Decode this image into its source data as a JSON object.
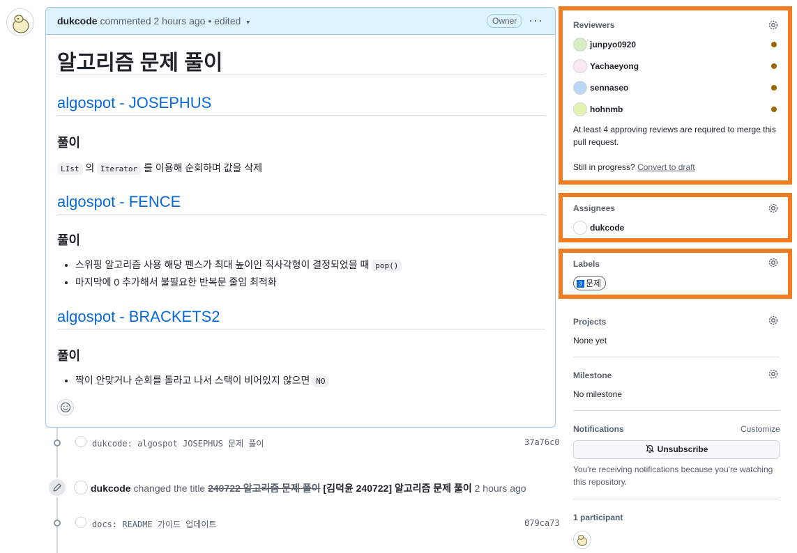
{
  "comment": {
    "author": "dukcode",
    "meta": "commented 2 hours ago • edited",
    "badge": "Owner",
    "menu": "···",
    "title": "알고리즘 문제 풀이",
    "sections": [
      {
        "heading": "algospot - JOSEPHUS",
        "subheading": "풀이",
        "code1": "LIst",
        "text1": "의",
        "code2": "Iterator",
        "text2": "를 이용해 순회하며 값을 삭제"
      },
      {
        "heading": "algospot - FENCE",
        "subheading": "풀이",
        "bullet1_text": "스위핑 알고리즘 사용 해당 펜스가 최대 높이인 직사각형이 결정되었을 때",
        "bullet1_code": "pop()",
        "bullet2_text": "마지막에 0 추가해서 불필요한 반복문 줄임 최적화"
      },
      {
        "heading": "algospot - BRACKETS2",
        "subheading": "풀이",
        "bullet1_text": "짝이 안맞거나 순회를 돌라고 나서 스택이 비어있지 않으면",
        "bullet1_code": "NO"
      }
    ]
  },
  "timeline": {
    "commit1": {
      "message": "dukcode: algospot JOSEPHUS 문제 풀이",
      "sha": "37a76c0"
    },
    "rename": {
      "actor": "dukcode",
      "action": "changed the title",
      "old_title": "240722 알고리즘 문제 풀이",
      "new_title": "[김덕윤 240722] 알고리즘 문제 풀이",
      "time": "2 hours ago"
    },
    "commit2": {
      "message": "docs: README 가이드 업데이트",
      "sha": "079ca73"
    }
  },
  "sidebar": {
    "reviewers": {
      "title": "Reviewers",
      "people": [
        "junpyo0920",
        "Yachaeyong",
        "sennaseo",
        "hohnmb"
      ],
      "note": "At least 4 approving reviews are required to merge this pull request.",
      "progress_text": "Still in progress?",
      "draft_link": "Convert to draft"
    },
    "assignees": {
      "title": "Assignees",
      "name": "dukcode"
    },
    "labels": {
      "title": "Labels",
      "label": "문제",
      "label_icon": "3"
    },
    "projects": {
      "title": "Projects",
      "value": "None yet"
    },
    "milestone": {
      "title": "Milestone",
      "value": "No milestone"
    },
    "notifications": {
      "title": "Notifications",
      "customize": "Customize",
      "button": "Unsubscribe",
      "note": "You're receiving notifications because you're watching this repository."
    },
    "participants": {
      "title": "1 participant"
    }
  },
  "colors": {
    "highlight": "#f47c20",
    "link": "#0969da",
    "pending_dot": "#9a6700"
  }
}
